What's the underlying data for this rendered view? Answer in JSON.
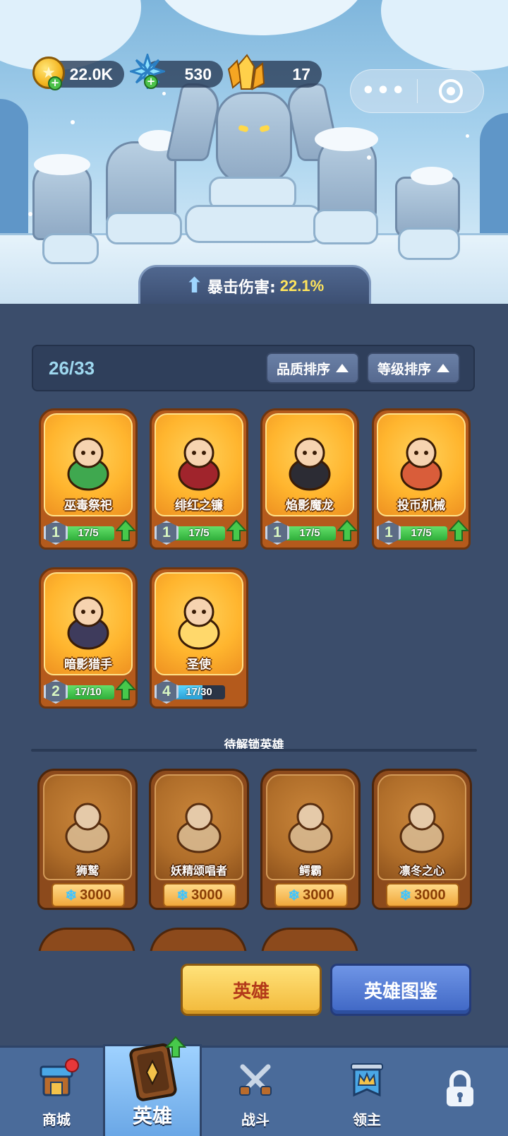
{
  "resources": {
    "gold": "22.0K",
    "gems": "530",
    "crystals": "17"
  },
  "capsule": {
    "menu": "•••"
  },
  "bonus": {
    "label": "暴击伤害:",
    "value": "22.1%"
  },
  "collection": {
    "count": "26/33",
    "sort_quality": "品质排序",
    "sort_level": "等级排序"
  },
  "heroes": [
    {
      "name": "巫毒祭祀",
      "level": "1",
      "progress": "17/5",
      "fill": 1.0,
      "upgradable": true
    },
    {
      "name": "绯红之镰",
      "level": "1",
      "progress": "17/5",
      "fill": 1.0,
      "upgradable": true
    },
    {
      "name": "焰影魔龙",
      "level": "1",
      "progress": "17/5",
      "fill": 1.0,
      "upgradable": true
    },
    {
      "name": "投币机械",
      "level": "1",
      "progress": "17/5",
      "fill": 1.0,
      "upgradable": true
    },
    {
      "name": "暗影猎手",
      "level": "2",
      "progress": "17/10",
      "fill": 1.0,
      "upgradable": true
    },
    {
      "name": "圣使",
      "level": "4",
      "progress": "17/30",
      "fill": 0.57,
      "upgradable": false
    }
  ],
  "locked": {
    "title": "待解锁英雄",
    "heroes": [
      {
        "name": "狮鹫",
        "price": "3000"
      },
      {
        "name": "妖精颂唱者",
        "price": "3000"
      },
      {
        "name": "鳄霸",
        "price": "3000"
      },
      {
        "name": "凛冬之心",
        "price": "3000"
      }
    ]
  },
  "actions": {
    "heroes": "英雄",
    "codex": "英雄图鉴"
  },
  "nav": {
    "shop": "商城",
    "heroes": "英雄",
    "battle": "战斗",
    "lord": "领主"
  }
}
